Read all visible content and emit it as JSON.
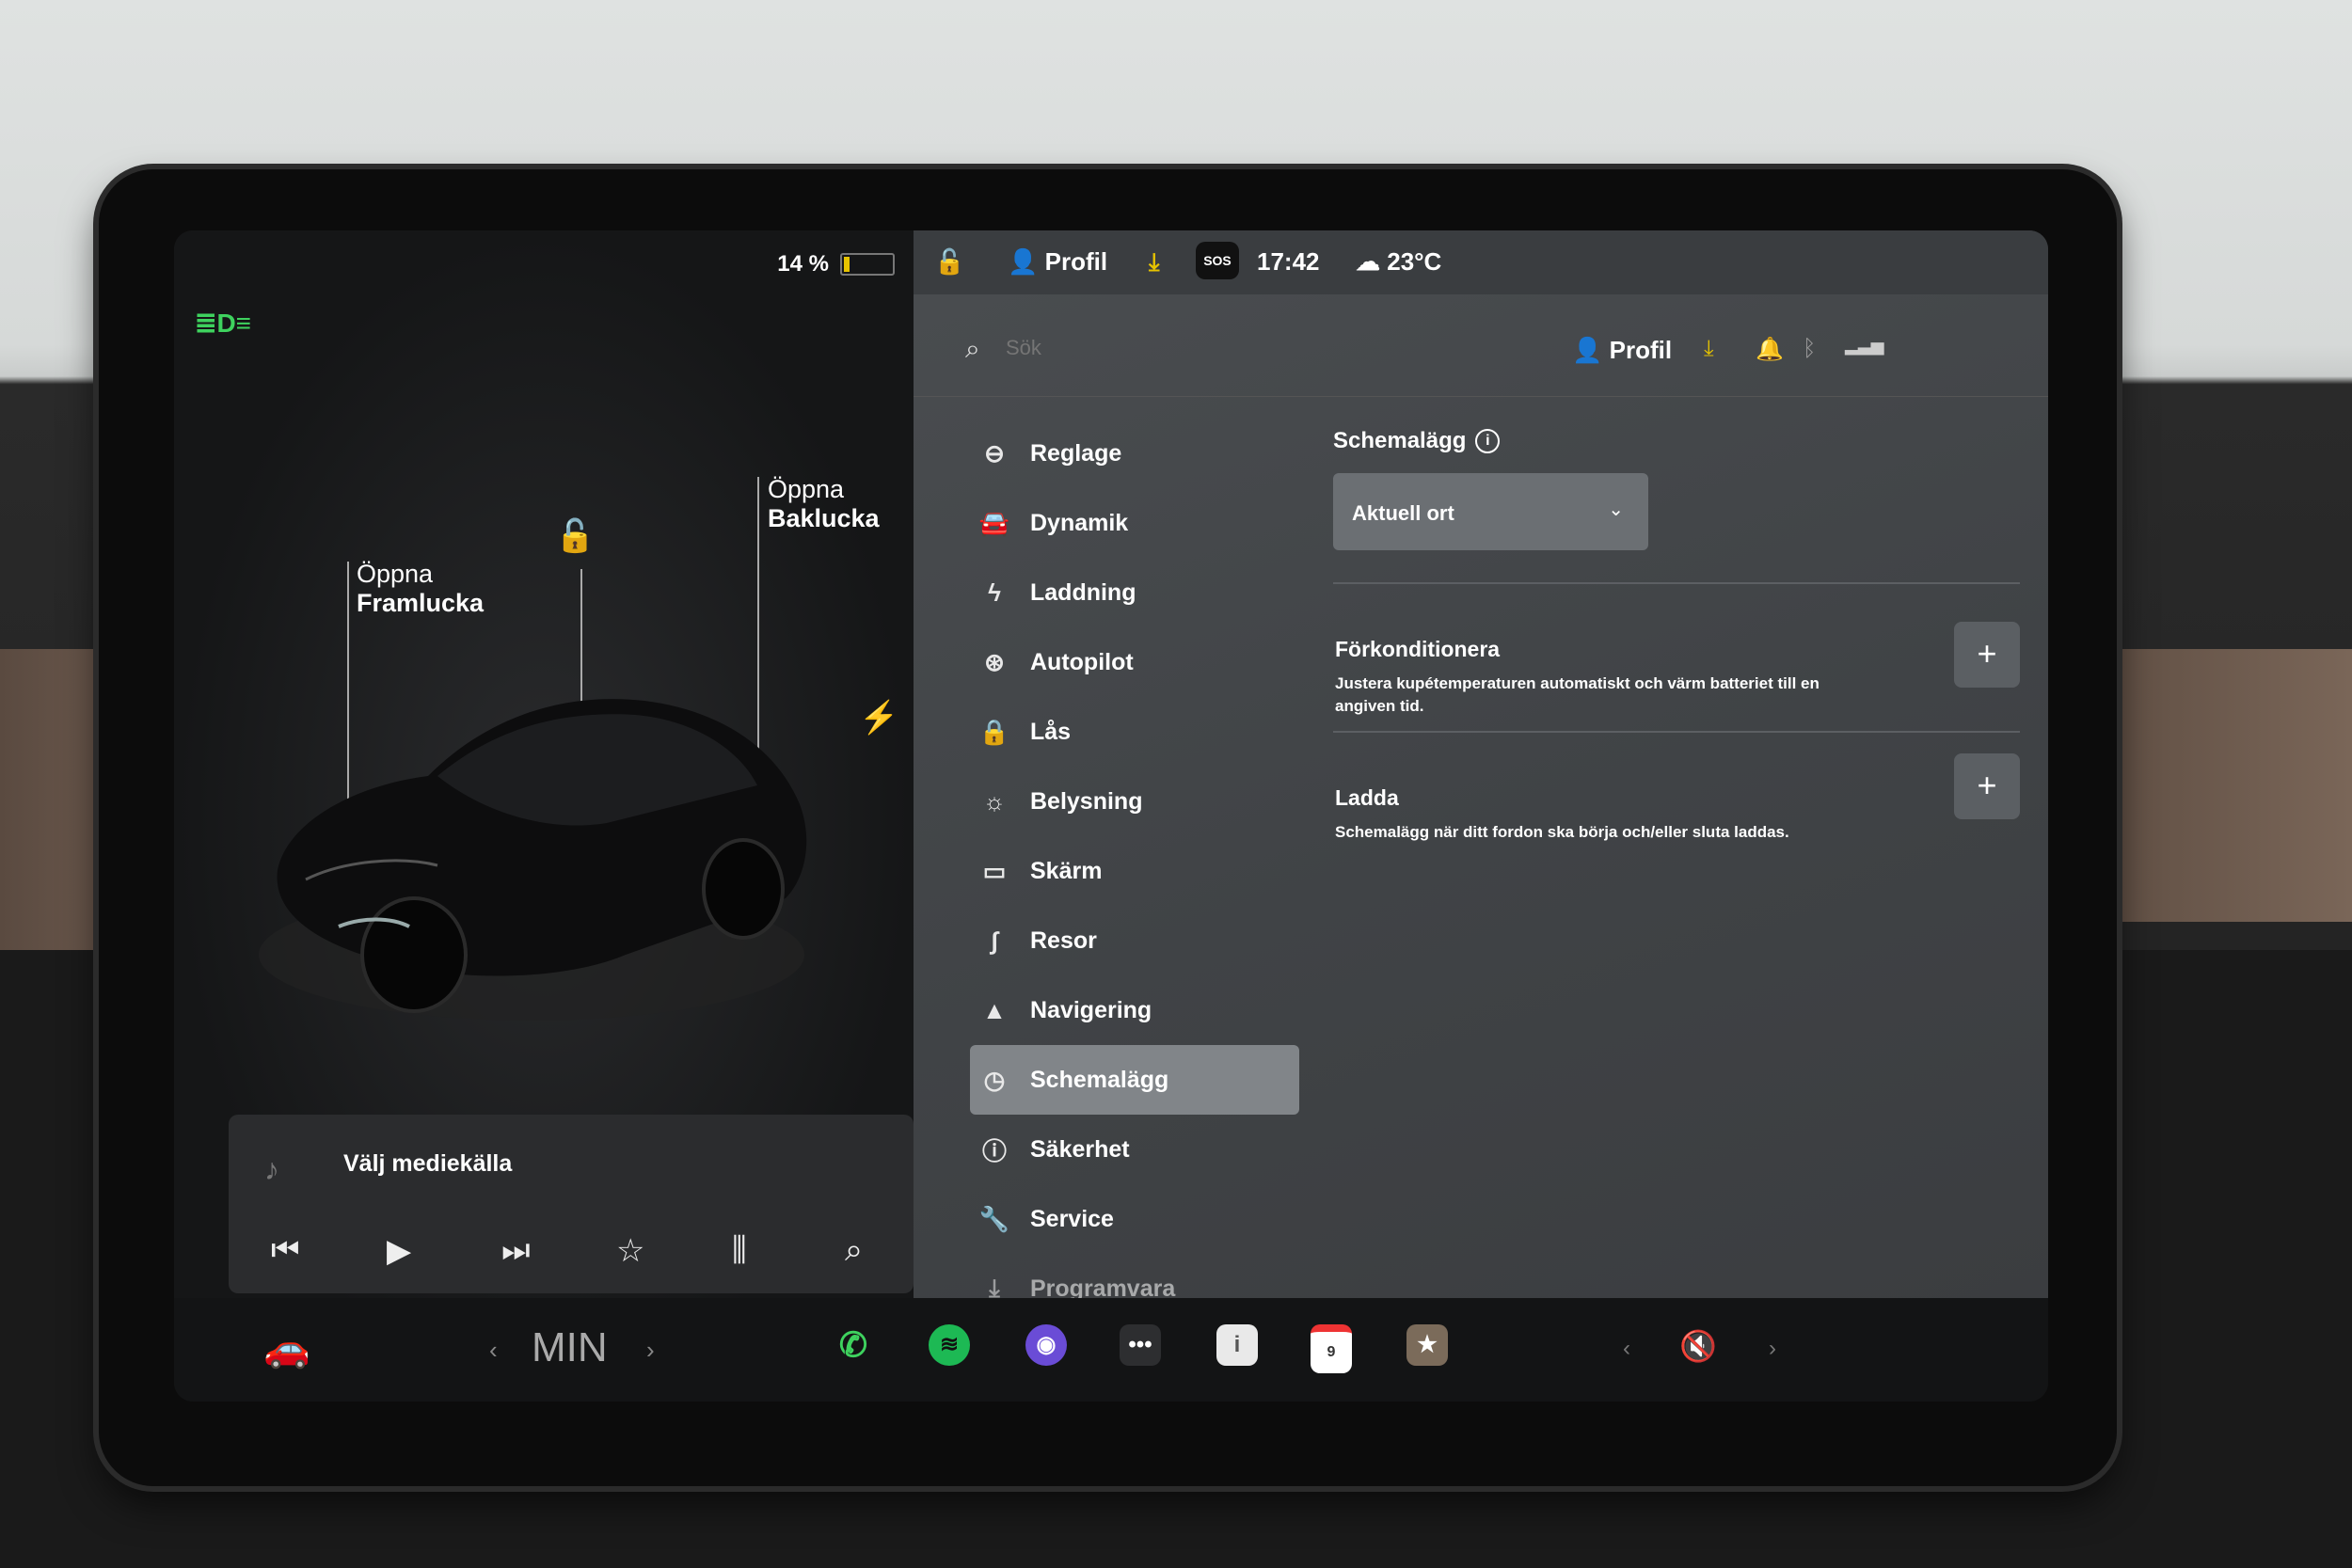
{
  "status": {
    "battery_pct": "14 %",
    "profile": "Profil",
    "sos": "SOS",
    "time": "17:42",
    "temperature": "23°C"
  },
  "car": {
    "front_trunk_label_1": "Öppna",
    "front_trunk_label_2": "Framlucka",
    "rear_trunk_label_1": "Öppna",
    "rear_trunk_label_2": "Baklucka"
  },
  "media": {
    "source_label": "Välj mediekälla"
  },
  "settings": {
    "search_placeholder": "Sök",
    "profile": "Profil",
    "menu": [
      {
        "label": "Reglage",
        "icon": "toggle-icon"
      },
      {
        "label": "Dynamik",
        "icon": "car-icon"
      },
      {
        "label": "Laddning",
        "icon": "bolt-icon"
      },
      {
        "label": "Autopilot",
        "icon": "steering-wheel-icon"
      },
      {
        "label": "Lås",
        "icon": "lock-icon"
      },
      {
        "label": "Belysning",
        "icon": "sun-icon"
      },
      {
        "label": "Skärm",
        "icon": "display-icon"
      },
      {
        "label": "Resor",
        "icon": "trips-icon"
      },
      {
        "label": "Navigering",
        "icon": "navigation-icon"
      },
      {
        "label": "Schemalägg",
        "icon": "clock-icon"
      },
      {
        "label": "Säkerhet",
        "icon": "shield-icon"
      },
      {
        "label": "Service",
        "icon": "wrench-icon"
      },
      {
        "label": "Programvara",
        "icon": "download-icon"
      }
    ],
    "active_index": 9,
    "schedule": {
      "title": "Schemalägg",
      "location_value": "Aktuell ort",
      "precondition_title": "Förkonditionera",
      "precondition_desc": "Justera kupétemperaturen automatiskt och värm batteriet till en angiven tid.",
      "charge_title": "Ladda",
      "charge_desc": "Schemalägg när ditt fordon ska börja och/eller sluta laddas."
    }
  },
  "dock": {
    "climate": "MIN",
    "calendar_day": "9"
  },
  "colors": {
    "accent_green": "#3ed25e",
    "download_yellow": "#e6c300",
    "active_menu": "#818589"
  }
}
